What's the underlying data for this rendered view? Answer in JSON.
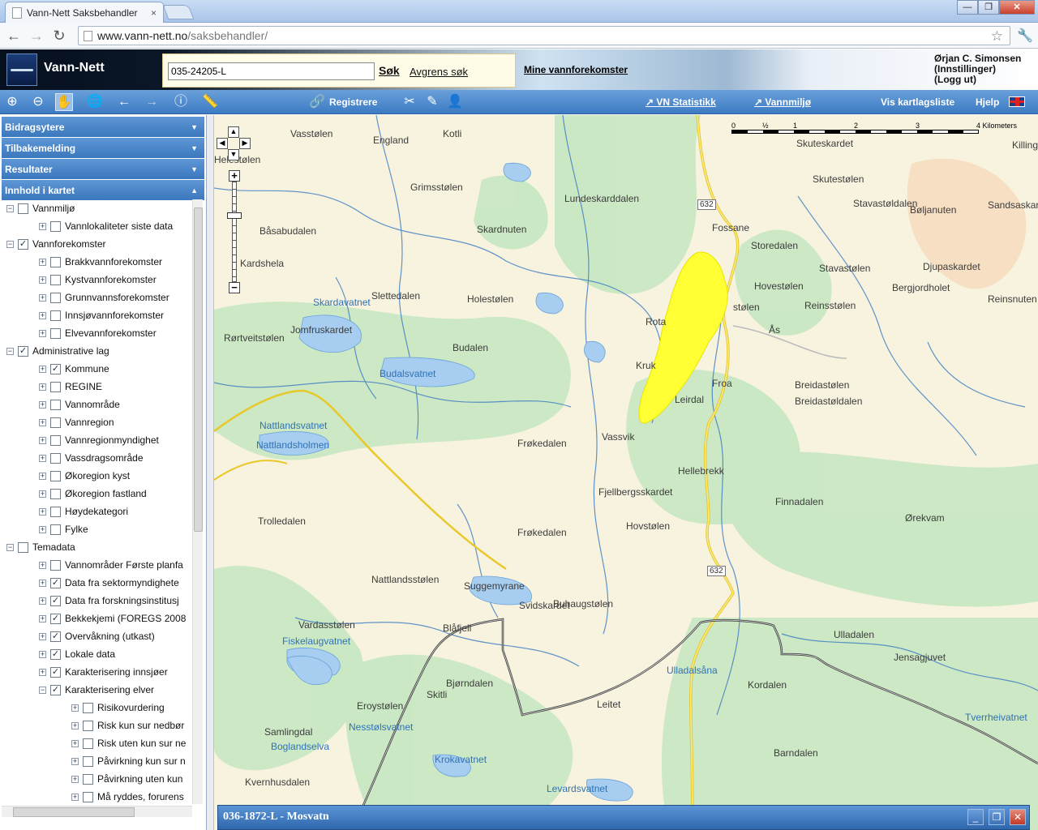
{
  "browser": {
    "tab_title": "Vann-Nett Saksbehandler",
    "tab_close": "×",
    "url_host": "www.vann-nett.no",
    "url_path": "/saksbehandler/",
    "back_icon": "←",
    "forward_icon": "→",
    "reload_icon": "↻"
  },
  "header": {
    "brand": "Vann-Nett",
    "search_value": "035-24205-L",
    "search_button": "Søk",
    "refine_link": "Avgrens søk",
    "my_waterbodies": "Mine vannforekomster",
    "user_name": "Ørjan C. Simonsen",
    "user_settings": "(Innstillinger)",
    "user_logout": "(Logg ut)"
  },
  "maptoolbar": {
    "register_label": "Registrere",
    "stats_link": "VN Statistikk",
    "env_link": "Vannmiljø",
    "layer_list_link": "Vis kartlagsliste",
    "help_link": "Hjelp",
    "colors": {
      "bar": "#3c7bc3"
    }
  },
  "sidebar": {
    "sections": [
      "Bidragsytere",
      "Tilbakemelding",
      "Resultater",
      "Innhold i kartet"
    ],
    "tree": [
      {
        "level": 0,
        "label": "Vannmiljø",
        "checked": false,
        "expanded": true
      },
      {
        "level": 1,
        "label": "Vannlokaliteter siste data",
        "checked": false,
        "expanded": false
      },
      {
        "level": 0,
        "label": "Vannforekomster",
        "checked": true,
        "expanded": true
      },
      {
        "level": 1,
        "label": "Brakkvannforekomster",
        "checked": false,
        "expanded": false
      },
      {
        "level": 1,
        "label": "Kystvannforekomster",
        "checked": false,
        "expanded": false
      },
      {
        "level": 1,
        "label": "Grunnvannsforekomster",
        "checked": false,
        "expanded": false
      },
      {
        "level": 1,
        "label": "Innsjøvannforekomster",
        "checked": false,
        "expanded": false
      },
      {
        "level": 1,
        "label": "Elvevannforekomster",
        "checked": false,
        "expanded": false
      },
      {
        "level": 0,
        "label": "Administrative lag",
        "checked": true,
        "expanded": true
      },
      {
        "level": 1,
        "label": "Kommune",
        "checked": true,
        "expanded": false
      },
      {
        "level": 1,
        "label": "REGINE",
        "checked": false,
        "expanded": false
      },
      {
        "level": 1,
        "label": "Vannområde",
        "checked": false,
        "expanded": false
      },
      {
        "level": 1,
        "label": "Vannregion",
        "checked": false,
        "expanded": false
      },
      {
        "level": 1,
        "label": "Vannregionmyndighet",
        "checked": false,
        "expanded": false
      },
      {
        "level": 1,
        "label": "Vassdragsområde",
        "checked": false,
        "expanded": false
      },
      {
        "level": 1,
        "label": "Økoregion kyst",
        "checked": false,
        "expanded": false
      },
      {
        "level": 1,
        "label": "Økoregion fastland",
        "checked": false,
        "expanded": false
      },
      {
        "level": 1,
        "label": "Høydekategori",
        "checked": false,
        "expanded": false
      },
      {
        "level": 1,
        "label": "Fylke",
        "checked": false,
        "expanded": false
      },
      {
        "level": 0,
        "label": "Temadata",
        "checked": false,
        "expanded": true
      },
      {
        "level": 1,
        "label": "Vannområder Første planfa",
        "checked": false,
        "expanded": false
      },
      {
        "level": 1,
        "label": "Data fra sektormyndighete",
        "checked": true,
        "expanded": false
      },
      {
        "level": 1,
        "label": "Data fra forskningsinstitusj",
        "checked": true,
        "expanded": false
      },
      {
        "level": 1,
        "label": "Bekkekjemi (FOREGS 2008",
        "checked": true,
        "expanded": false
      },
      {
        "level": 1,
        "label": "Overvåkning (utkast)",
        "checked": true,
        "expanded": false
      },
      {
        "level": 1,
        "label": "Lokale data",
        "checked": true,
        "expanded": false
      },
      {
        "level": 1,
        "label": "Karakterisering innsjøer",
        "checked": true,
        "expanded": false
      },
      {
        "level": 1,
        "label": "Karakterisering elver",
        "checked": true,
        "expanded": true
      },
      {
        "level": 2,
        "label": "Risikovurdering",
        "checked": false,
        "expanded": false
      },
      {
        "level": 2,
        "label": "Risk kun sur nedbør",
        "checked": false,
        "expanded": false
      },
      {
        "level": 2,
        "label": "Risk uten kun sur ne",
        "checked": false,
        "expanded": false
      },
      {
        "level": 2,
        "label": "Påvirkning kun sur n",
        "checked": false,
        "expanded": false
      },
      {
        "level": 2,
        "label": "Påvirkning uten kun",
        "checked": false,
        "expanded": false
      },
      {
        "level": 2,
        "label": "Må ryddes, forurens",
        "checked": false,
        "expanded": false
      }
    ]
  },
  "map": {
    "scale_labels": [
      "0",
      "½",
      "1",
      "2",
      "3",
      "4 Kilometers"
    ],
    "place_labels": [
      "Vasstølen",
      "Kotli",
      "England",
      "Helestølen",
      "Grimsstølen",
      "Lundeskarddalen",
      "Fossane",
      "Skuteskardet",
      "Killingeska",
      "Skutestølen",
      "Stavastøldalen",
      "Sandsaskard",
      "Bøljanuten",
      "Båsabudalen",
      "Skardnuten",
      "Storedalen",
      "Djupaskardet",
      "Kardshela",
      "Stavastølen",
      "Hovestølen",
      "Bergjordholet",
      "Reinsnuten",
      "Slettedalen",
      "Holestølen",
      "stølen",
      "Reinsstølen",
      "Jomfruskardet",
      "Rota",
      "Ås",
      "Rørtveitstølen",
      "Budalen",
      "Kruk",
      "Froa",
      "Breidastølen",
      "Breidastøldalen",
      "Leirdal",
      "Vassvik",
      "Frøkedalen",
      "Hellebrekk",
      "Fjellbergsskardet",
      "Finnadalen",
      "Trolledalen",
      "Hovstølen",
      "Ørekvam",
      "Frøkedalen",
      "Nattlandsstølen",
      "Suggemyrane",
      "Svidskardet",
      "Buhaugstølen",
      "Vardasstølen",
      "Blåfjell",
      "Ulladalen",
      "Jensagjuvet",
      "Bjørndalen",
      "Kordalen",
      "Skitli",
      "Eroystølen",
      "Leitet",
      "Samlingdal",
      "Barndalen",
      "Kvernhusdalen"
    ],
    "water_labels": [
      "Skardavatnet",
      "Budalsvatnet",
      "Nattlandsvatnet",
      "Nattlandsholmen",
      "Fiskelaugvatnet",
      "Ulladalsåna",
      "Tverrheivatnet",
      "Nesstølsvatnet",
      "Boglandselva",
      "Krokavatnet",
      "Levardsvatnet"
    ],
    "road_shields": [
      "632",
      "632"
    ],
    "highlight_color": "#ffff33"
  },
  "bottom_panel": {
    "title": "036-1872-L - Mosvatn",
    "minimize": "_",
    "restore": "❐",
    "close": "✕"
  }
}
